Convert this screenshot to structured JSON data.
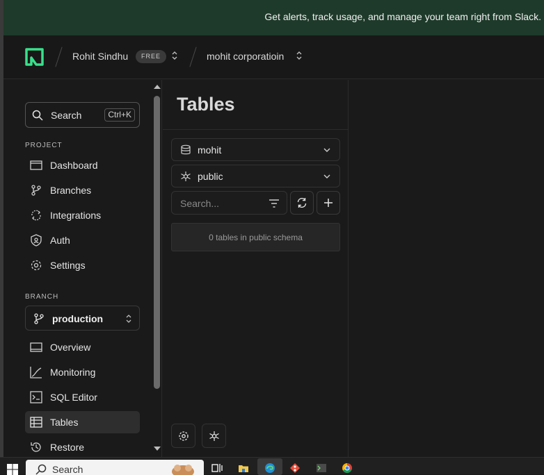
{
  "banner": {
    "text": "Get alerts, track usage, and manage your team right from Slack."
  },
  "topbar": {
    "logo_icon": "neon-logo-icon",
    "account_name": "Rohit Sindhu",
    "plan_badge": "FREE",
    "project_name": "mohit corporatioin"
  },
  "sidebar": {
    "search": {
      "label": "Search",
      "shortcut": "Ctrl+K"
    },
    "project_section": "PROJECT",
    "project_items": [
      {
        "label": "Dashboard",
        "icon": "dashboard-icon"
      },
      {
        "label": "Branches",
        "icon": "branches-icon"
      },
      {
        "label": "Integrations",
        "icon": "integrations-icon"
      },
      {
        "label": "Auth",
        "icon": "auth-icon"
      },
      {
        "label": "Settings",
        "icon": "settings-icon"
      }
    ],
    "branch_section": "BRANCH",
    "branch_select": "production",
    "branch_items": [
      {
        "label": "Overview",
        "icon": "overview-icon"
      },
      {
        "label": "Monitoring",
        "icon": "monitoring-icon"
      },
      {
        "label": "SQL Editor",
        "icon": "sql-editor-icon"
      },
      {
        "label": "Tables",
        "icon": "tables-icon",
        "active": true
      },
      {
        "label": "Restore",
        "icon": "restore-icon"
      }
    ]
  },
  "tables_panel": {
    "title": "Tables",
    "database_select": "mohit",
    "schema_select": "public",
    "search_placeholder": "Search...",
    "empty_message": "0 tables in public schema"
  },
  "taskbar": {
    "search_label": "Search"
  },
  "colors": {
    "banner_bg": "#1e3a2a",
    "logo_green": "#38e08a",
    "active_item_bg": "#2e2e2e"
  }
}
